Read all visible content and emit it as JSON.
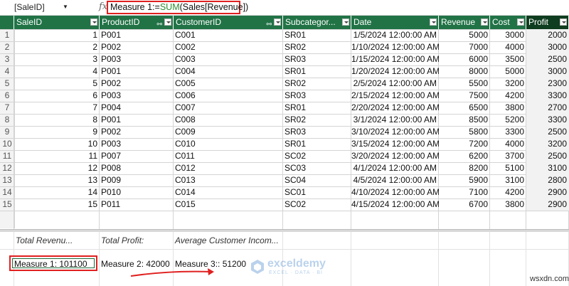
{
  "formula_bar": {
    "name_box": "[SaleID]",
    "fx": "fx",
    "formula_prefix": "Measure 1:=",
    "formula_fn": "SUM",
    "formula_arg": "(Sales[Revenue])"
  },
  "columns": [
    {
      "label": "SaleID",
      "dropdown": true,
      "key": false,
      "active": false
    },
    {
      "label": "ProductID",
      "dropdown": true,
      "key": true,
      "active": false
    },
    {
      "label": "CustomerID",
      "dropdown": true,
      "key": true,
      "active": false
    },
    {
      "label": "Subcategor...",
      "dropdown": true,
      "key": false,
      "active": false
    },
    {
      "label": "Date",
      "dropdown": true,
      "key": false,
      "active": false
    },
    {
      "label": "Revenue",
      "dropdown": true,
      "key": false,
      "active": false
    },
    {
      "label": "Cost",
      "dropdown": true,
      "key": false,
      "active": false
    },
    {
      "label": "Profit",
      "dropdown": true,
      "key": false,
      "active": true
    }
  ],
  "rows": [
    [
      "1",
      "P001",
      "C001",
      "SR01",
      "1/5/2024 12:00:00 AM",
      "5000",
      "3000",
      "2000"
    ],
    [
      "2",
      "P002",
      "C002",
      "SR02",
      "1/10/2024 12:00:00 AM",
      "7000",
      "4000",
      "3000"
    ],
    [
      "3",
      "P003",
      "C003",
      "SR03",
      "1/15/2024 12:00:00 AM",
      "6000",
      "3500",
      "2500"
    ],
    [
      "4",
      "P001",
      "C004",
      "SR01",
      "1/20/2024 12:00:00 AM",
      "8000",
      "5000",
      "3000"
    ],
    [
      "5",
      "P002",
      "C005",
      "SR02",
      "2/5/2024 12:00:00 AM",
      "5500",
      "3200",
      "2300"
    ],
    [
      "6",
      "P003",
      "C006",
      "SR03",
      "2/15/2024 12:00:00 AM",
      "7500",
      "4200",
      "3300"
    ],
    [
      "7",
      "P004",
      "C007",
      "SR01",
      "2/20/2024 12:00:00 AM",
      "6500",
      "3800",
      "2700"
    ],
    [
      "8",
      "P001",
      "C008",
      "SR02",
      "3/1/2024 12:00:00 AM",
      "8500",
      "5200",
      "3300"
    ],
    [
      "9",
      "P002",
      "C009",
      "SR03",
      "3/10/2024 12:00:00 AM",
      "5800",
      "3300",
      "2500"
    ],
    [
      "10",
      "P003",
      "C010",
      "SR01",
      "3/15/2024 12:00:00 AM",
      "7200",
      "4000",
      "3200"
    ],
    [
      "11",
      "P007",
      "C011",
      "SC02",
      "3/20/2024 12:00:00 AM",
      "6200",
      "3700",
      "2500"
    ],
    [
      "12",
      "P008",
      "C012",
      "SC03",
      "4/1/2024 12:00:00 AM",
      "8200",
      "5100",
      "3100"
    ],
    [
      "13",
      "P009",
      "C013",
      "SC04",
      "4/5/2024 12:00:00 AM",
      "5900",
      "3100",
      "2800"
    ],
    [
      "14",
      "P010",
      "C014",
      "SC01",
      "4/10/2024 12:00:00 AM",
      "7100",
      "4200",
      "2900"
    ],
    [
      "15",
      "P011",
      "C015",
      "SC02",
      "4/15/2024 12:00:00 AM",
      "6700",
      "3800",
      "2900"
    ]
  ],
  "calc_area": {
    "headers": [
      "Total Revenu...",
      "Total Profit:",
      "Average Customer Incom..."
    ],
    "measures": [
      "Measure 1: 101100",
      "Measure 2: 42000",
      "Measure 3:: 51200"
    ]
  },
  "watermark": {
    "name": "exceldemy",
    "tagline": "EXCEL · DATA · BI"
  },
  "site_label": "wsxdn.com",
  "colors": {
    "header_bg": "#217346",
    "header_active_bg": "#0f3d1f",
    "highlight": "#e02020",
    "formula_fn": "#2e8b2e"
  }
}
